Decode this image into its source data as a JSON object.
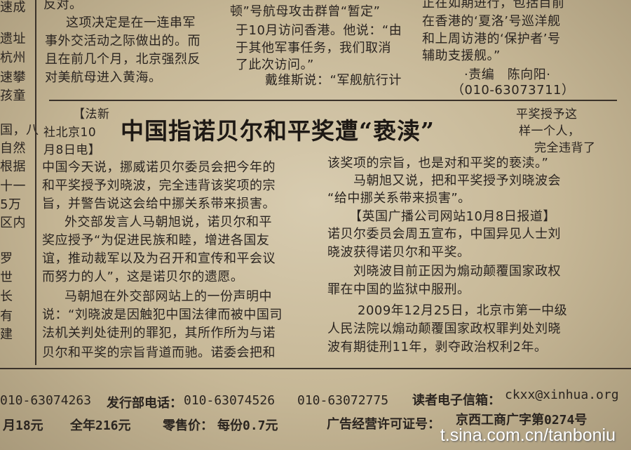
{
  "left_strip": [
    "速成",
    "遗址",
    "杭州",
    "速攀",
    "孩童",
    "国，八",
    "自然",
    "根据",
    "十一",
    "5万",
    "区内",
    "罗",
    "世",
    "长",
    "有",
    "建"
  ],
  "top_col1": [
    "反对。",
    "这项决定是在一连串军",
    "事外交活动之际做出的。而",
    "且在前几个月，北京强烈反",
    "对美航母进入黄海。"
  ],
  "top_col2": [
    "顿”号航母攻击群曾“暂定”",
    "于10月访问香港。他说：“由",
    "于其他军事任务，我们取消",
    "了此次访问。”",
    "戴维斯说：“军舰航行计"
  ],
  "top_col3": [
    "正在如期进行，包括目前",
    "在香港的‘夏洛’号巡洋舰",
    "和上周访港的‘保护者’号",
    "辅助支援舰。”",
    "·责编　陈向阳·",
    "（010-63073711）"
  ],
  "article": {
    "dateline": [
      "【法新",
      "社北京10",
      "月8日电】"
    ],
    "headline": "中国指诺贝尔和平奖遭“亵渎”",
    "side_quote": [
      "平奖授予这",
      "样一个人，",
      "完全违背了"
    ],
    "col1": [
      "中国今天说，挪威诺贝尔委员会把今年的",
      "和平奖授予刘晓波，完全违背该奖项的宗",
      "旨，并警告说这会给中挪关系带来损害。",
      "外交部发言人马朝旭说，诺贝尔和平",
      "奖应授予“为促进民族和睦，增进各国友",
      "谊，推动裁军以及为召开和宣传和平会议",
      "而努力的人”，这是诺贝尔的遗愿。",
      "马朝旭在外交部网站上的一份声明中",
      "说：“刘晓波是因触犯中国法律而被中国司",
      "法机关判处徒刑的罪犯，其所作所为与诺",
      "贝尔和平奖的宗旨背道而驰。诺委会把和"
    ],
    "col2": [
      "该奖项的宗旨，也是对和平奖的亵渎。”",
      "马朝旭又说，把和平奖授予刘晓波会",
      "“给中挪关系带来损害”。",
      "【英国广播公司网站10月8日报道】",
      "诺贝尔委员会周五宣布，中国异见人士刘",
      "晓波获得诺贝尔和平奖。",
      "刘晓波目前正因为煽动颠覆国家政权",
      "罪在中国的监狱中服刑。",
      "2009年12月25日，北京市第一中级",
      "人民法院以煽动颠覆国家政权罪判处刘晓",
      "波有期徒刑11年，剥夺政治权利2年。"
    ]
  },
  "footer": {
    "row1": [
      "010-63074263",
      "发行部电话：",
      "010-63074526",
      "010-63072775",
      "读者电子信箱：",
      "ckxx@xinhua.org"
    ],
    "row2": [
      "月18元",
      "全年216元",
      "零售价：",
      "每份0.7元",
      "广告经营许可证号：",
      "京西工商广字第0274号"
    ]
  },
  "watermark": "t.sina.com.cn/tanboniu"
}
